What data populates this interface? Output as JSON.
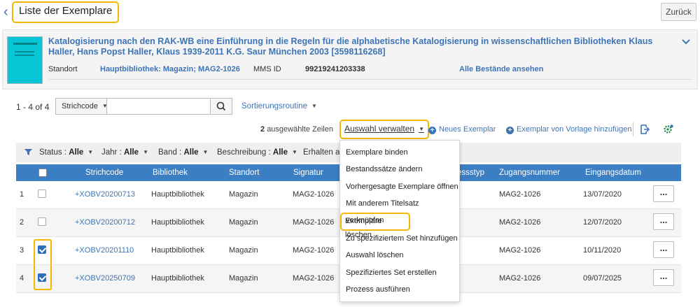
{
  "header": {
    "title": "Liste der Exemplare",
    "back_button": "Zurück"
  },
  "record": {
    "title": "Katalogisierung nach den RAK-WB eine Einführung in die Regeln für die alphabetische Katalogisierung in wissenschaftlichen Bibliotheken Klaus Haller, Hans Popst Haller, Klaus 1939-2011 K.G. Saur München 2003 [3598116268]",
    "location_label": "Standort",
    "location_value": "Hauptbibliothek: Magazin; MAG2-1026",
    "mms_label": "MMS ID",
    "mms_value": "99219241203338",
    "all_holdings_link": "Alle Bestände ansehen"
  },
  "search": {
    "count": "1 - 4 of 4",
    "field": "Strichcode",
    "value": "",
    "sort_label": "Sortierungsroutine"
  },
  "toolbar": {
    "selected_count": "2",
    "selected_text": "ausgewählte Zeilen",
    "manage_label": "Auswahl verwalten",
    "new_item": "Neues Exemplar",
    "from_template": "Exemplar von Vorlage hinzufügen"
  },
  "filters": [
    {
      "label": "Status :",
      "value": "Alle"
    },
    {
      "label": "Jahr :",
      "value": "Alle"
    },
    {
      "label": "Band :",
      "value": "Alle"
    },
    {
      "label": "Beschreibung :",
      "value": "Alle"
    },
    {
      "label": "Erhalten am",
      "value": ""
    }
  ],
  "table": {
    "columns": [
      "Strichcode",
      "Bibliothek",
      "Standort",
      "Signatur",
      "essstyp",
      "Zugangsnummer",
      "Eingangsdatum"
    ],
    "rows": [
      {
        "num": "1",
        "checked": false,
        "barcode": "+XOBV20200713",
        "library": "Hauptbibliothek",
        "location": "Magazin",
        "callnumber": "MAG2-1026",
        "accession": "MAG2-1026",
        "date": "13/07/2020"
      },
      {
        "num": "2",
        "checked": false,
        "barcode": "+XOBV20200712",
        "library": "Hauptbibliothek",
        "location": "Magazin",
        "callnumber": "MAG2-1026",
        "accession": "MAG2-1026",
        "date": "12/07/2020"
      },
      {
        "num": "3",
        "checked": true,
        "barcode": "+XOBV20201110",
        "library": "Hauptbibliothek",
        "location": "Magazin",
        "callnumber": "MAG2-1026",
        "accession": "MAG2-1026",
        "date": "10/11/2020"
      },
      {
        "num": "4",
        "checked": true,
        "barcode": "+XOBV20250709",
        "library": "Hauptbibliothek",
        "location": "Magazin",
        "callnumber": "MAG2-1026",
        "accession": "MAG2-1026",
        "date": "09/07/2025"
      }
    ],
    "row_action": "..."
  },
  "menu": {
    "items": [
      "Exemplare binden",
      "Bestandssätze ändern",
      "Vorhergesagte Exemplare öffnen",
      "Mit anderem Titelsatz verknüpfen",
      "Exemplare löschen",
      "Zu spezifiziertem Set hinzufügen",
      "Auswahl löschen",
      "Spezifiziertes Set erstellen",
      "Prozess ausführen"
    ]
  },
  "colors": {
    "accent": "#3c7ec2",
    "highlight": "#f5b700",
    "link": "#3d74b6"
  }
}
